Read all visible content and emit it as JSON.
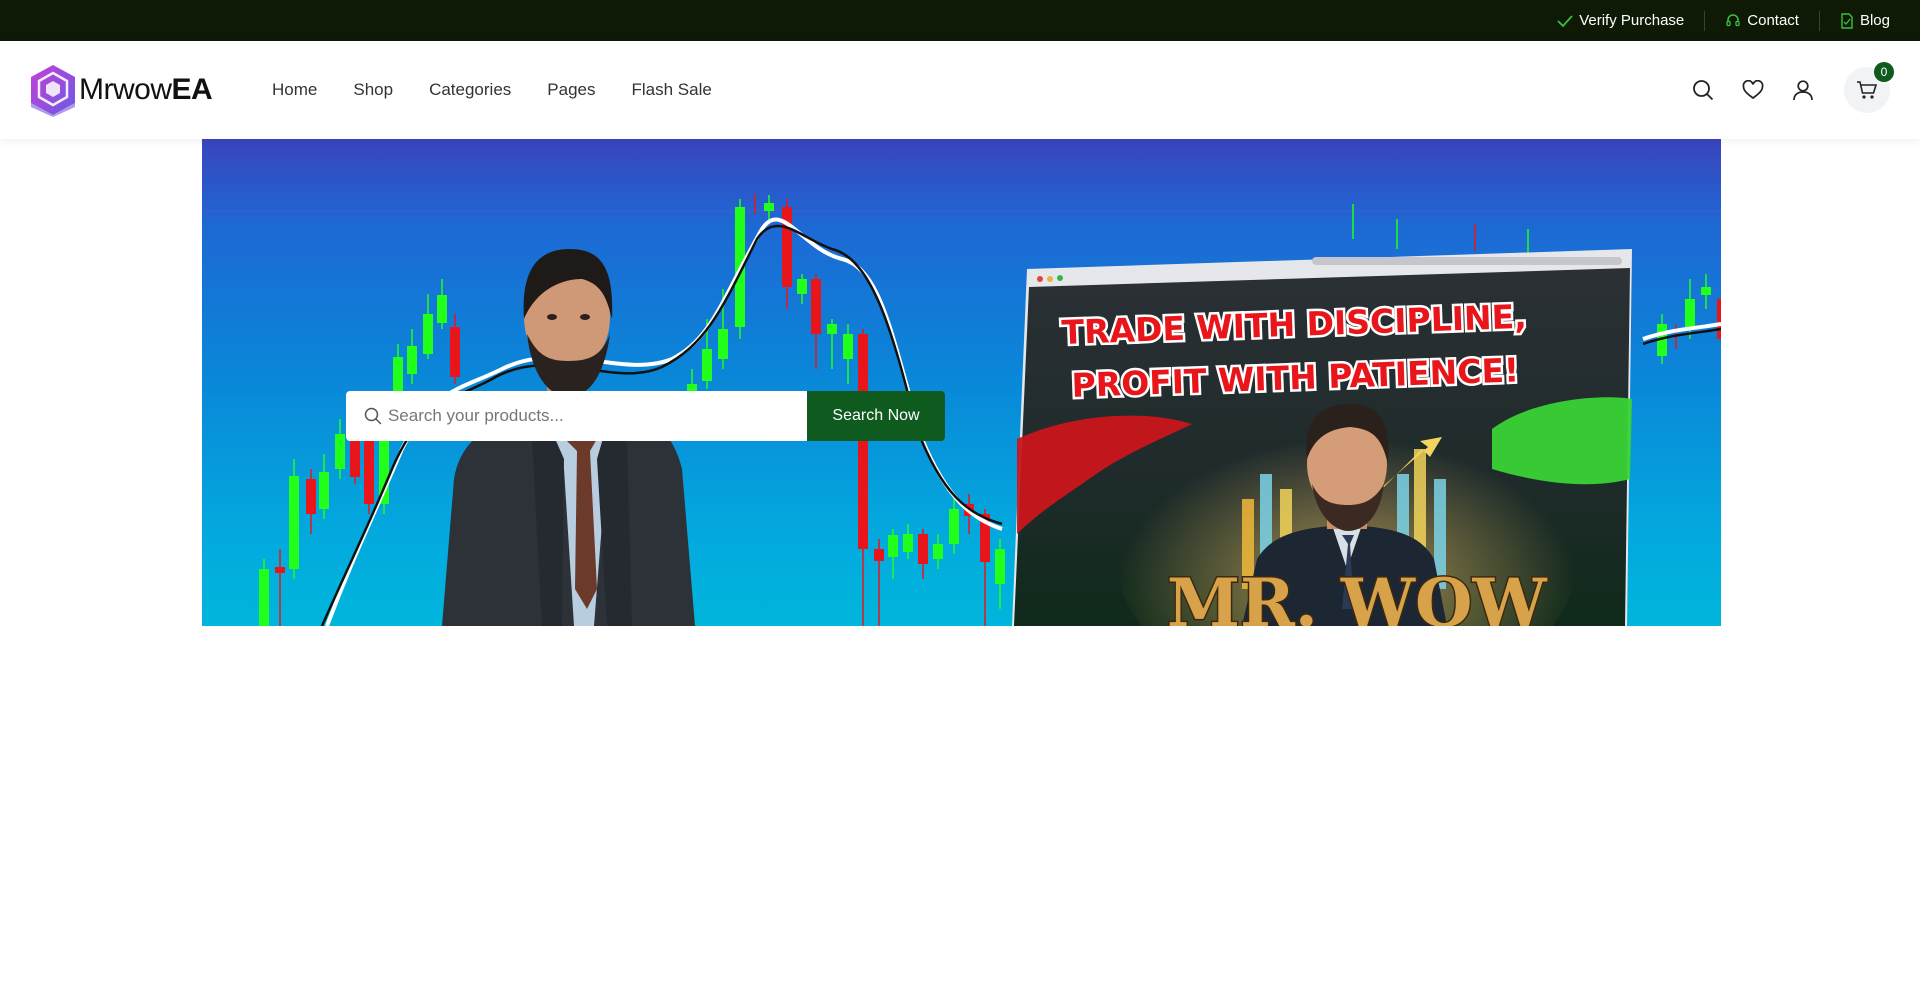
{
  "topbar": {
    "links": [
      {
        "label": "Verify Purchase",
        "icon": "check-icon"
      },
      {
        "label": "Contact",
        "icon": "headset-icon"
      },
      {
        "label": "Blog",
        "icon": "document-icon"
      }
    ]
  },
  "header": {
    "logo": {
      "text_regular": "Mrwow",
      "text_bold": "EA"
    },
    "nav": [
      "Home",
      "Shop",
      "Categories",
      "Pages",
      "Flash Sale"
    ],
    "icons": [
      "search-icon",
      "heart-icon",
      "user-icon",
      "cart-icon"
    ],
    "cart_count": "0"
  },
  "hero": {
    "search": {
      "placeholder": "Search your products...",
      "button_label": "Search Now"
    },
    "promo": {
      "line1": "TRADE WITH DISCIPLINE,",
      "line2": "PROFIT WITH PATIENCE!",
      "brand": "MR. WOW"
    }
  },
  "colors": {
    "topbar_bg": "#0e1a06",
    "accent_green": "#0e5a1f",
    "hero_top": "#3a44bd",
    "hero_bottom": "#00b6dc",
    "candle_up": "#22ff1a",
    "candle_down": "#e8161b"
  }
}
